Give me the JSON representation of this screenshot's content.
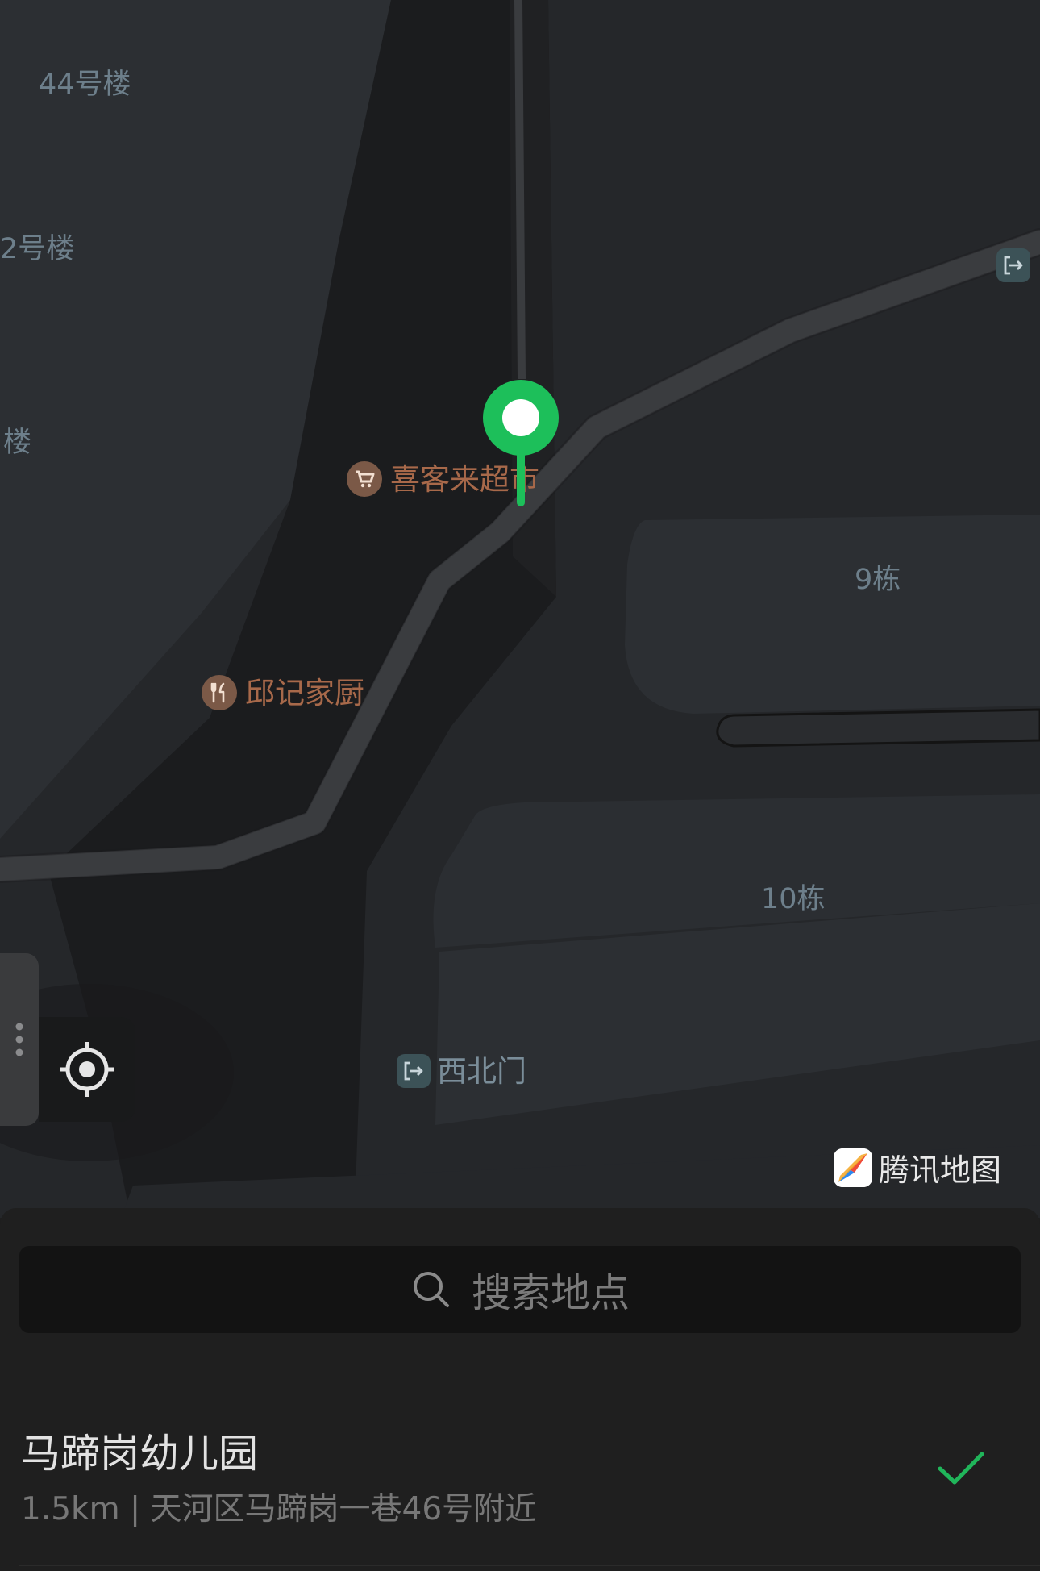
{
  "map": {
    "building_labels": [
      "44号楼",
      "2号楼",
      "楼",
      "9栋",
      "10栋"
    ],
    "pois": {
      "supermarket": "喜客来超市",
      "restaurant": "邱记家厨"
    },
    "gates": {
      "northwest_gate": "西北门"
    },
    "brand": "腾讯地图",
    "pin_color": "#1dbf5a"
  },
  "search": {
    "placeholder": "搜索地点"
  },
  "result": {
    "name": "马蹄岗幼儿园",
    "address": "1.5km | 天河区马蹄岗一巷46号附近",
    "selected": true,
    "check_color": "#20b55a"
  }
}
